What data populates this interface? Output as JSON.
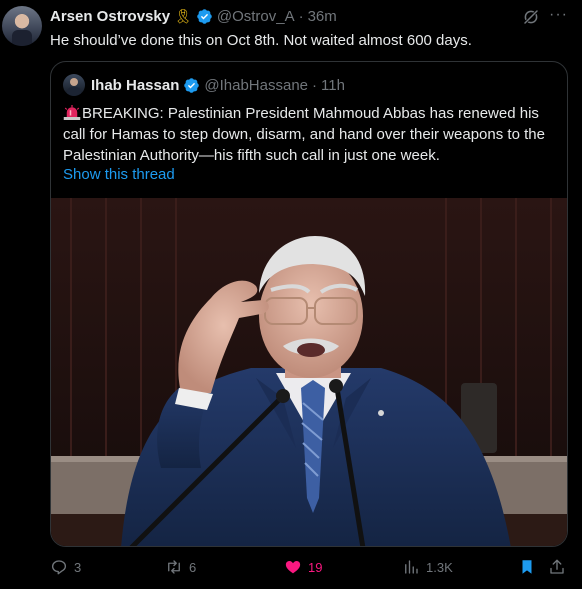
{
  "post": {
    "author_name": "Arsen Ostrovsky",
    "ribbon_icon": "yellow-ribbon-icon",
    "author_handle": "@Ostrov_A",
    "separator": "·",
    "time": "36m",
    "text": "He should’ve done this on Oct 8th. Not waited almost 600 days."
  },
  "quoted": {
    "author_name": "Ihab Hassan",
    "author_handle": "@IhabHassane",
    "separator": "·",
    "time": "11h",
    "text": "BREAKING: Palestinian President Mahmoud Abbas has renewed his call for Hamas to step down, disarm, and hand over their weapons to the Palestinian Authority—his fifth such call in just one week.",
    "show_thread": "Show this thread"
  },
  "actions": {
    "replies": "3",
    "reposts": "6",
    "likes": "19",
    "views": "1.3K"
  },
  "colors": {
    "background": "#000000",
    "text": "#e7e9ea",
    "muted": "#71767b",
    "accent": "#1d9bf0",
    "like": "#f91880",
    "border": "#2f3336"
  }
}
